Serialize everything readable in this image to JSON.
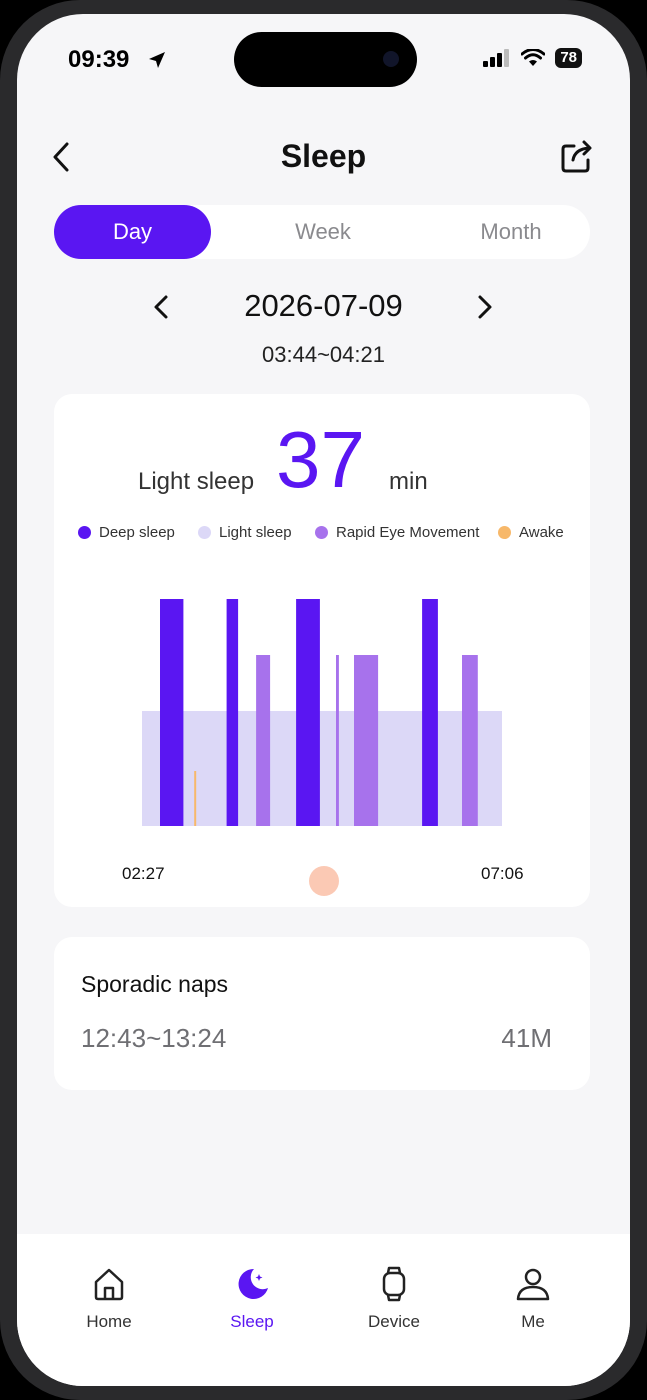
{
  "status_bar": {
    "time": "09:39",
    "battery": "78"
  },
  "header": {
    "title": "Sleep"
  },
  "segments": {
    "day": "Day",
    "week": "Week",
    "month": "Month",
    "selected": "Day"
  },
  "date_nav": {
    "date": "2026-07-09",
    "time_range": "03:44~04:21"
  },
  "summary": {
    "label": "Light sleep",
    "value": "37",
    "unit": "min"
  },
  "legend": [
    {
      "label": "Deep sleep",
      "color": "#5a16f2"
    },
    {
      "label": "Light sleep",
      "color": "#dcd8f7"
    },
    {
      "label": "Rapid Eye Movement",
      "color": "#a772ec"
    },
    {
      "label": "Awake",
      "color": "#f7b86a"
    }
  ],
  "chart_data": {
    "type": "bar",
    "x_start": "02:27",
    "x_end": "07:06",
    "colors": {
      "deep": "#5a16f2",
      "light": "#dcd8f7",
      "rem": "#a772ec",
      "awake": "#f7b86a"
    },
    "stages": [
      {
        "stage": "light",
        "start": 0.0,
        "end": 1.0
      },
      {
        "stage": "deep",
        "start": 0.05,
        "end": 0.115
      },
      {
        "stage": "awake",
        "start": 0.145,
        "end": 0.152
      },
      {
        "stage": "deep",
        "start": 0.235,
        "end": 0.267
      },
      {
        "stage": "rem",
        "start": 0.317,
        "end": 0.356
      },
      {
        "stage": "deep",
        "start": 0.428,
        "end": 0.494
      },
      {
        "stage": "rem",
        "start": 0.539,
        "end": 0.547
      },
      {
        "stage": "rem",
        "start": 0.589,
        "end": 0.656
      },
      {
        "stage": "deep",
        "start": 0.778,
        "end": 0.822
      },
      {
        "stage": "rem",
        "start": 0.889,
        "end": 0.933
      }
    ]
  },
  "naps": {
    "title": "Sporadic naps",
    "range": "12:43~13:24",
    "duration": "41M"
  },
  "tabbar": {
    "home": "Home",
    "sleep": "Sleep",
    "device": "Device",
    "me": "Me",
    "active": "Sleep"
  }
}
